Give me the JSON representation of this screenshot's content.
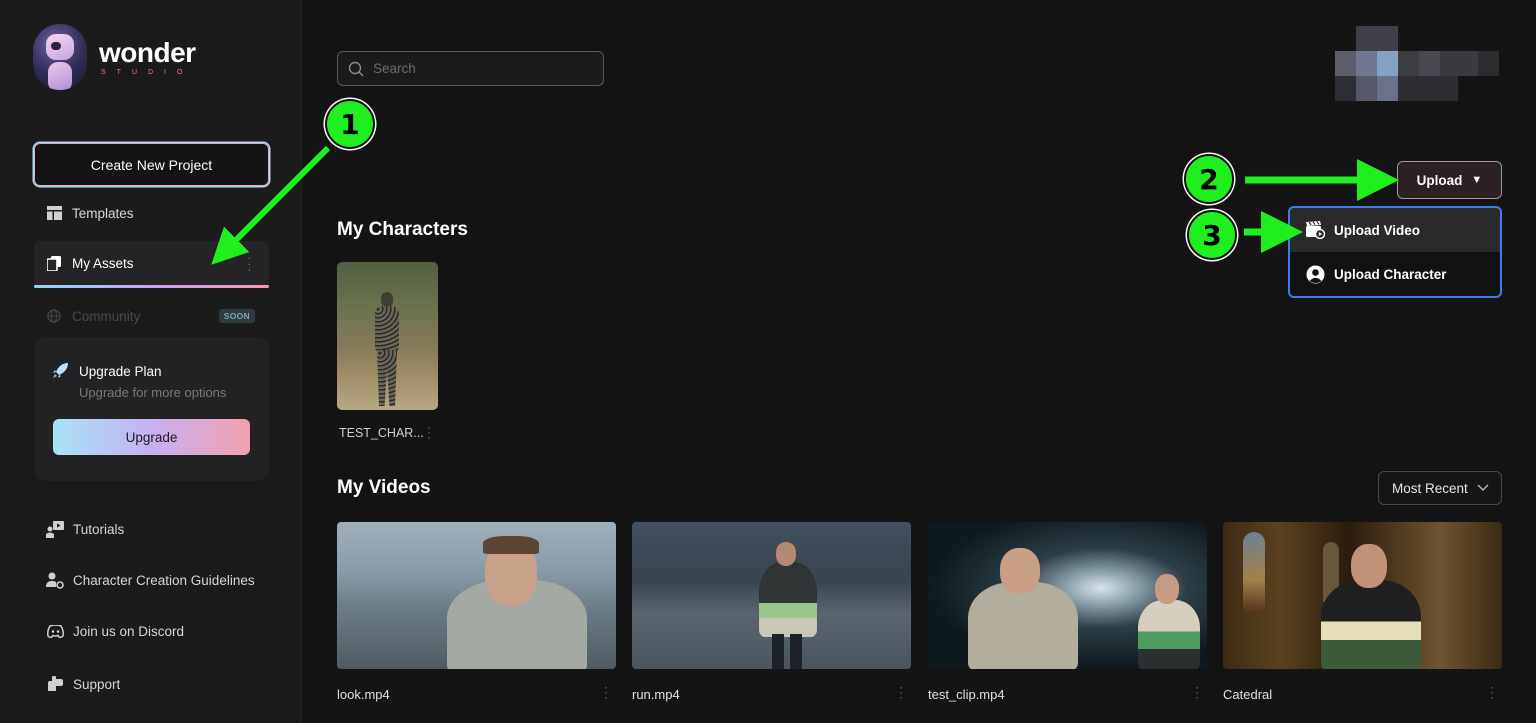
{
  "app": {
    "logo_word": "wonder",
    "logo_sub": "STUDIO"
  },
  "sidebar": {
    "create_button": "Create New Project",
    "items": [
      {
        "label": "Templates",
        "icon": "layout-icon"
      },
      {
        "label": "My Assets",
        "icon": "copy-icon",
        "active": true
      },
      {
        "label": "Community",
        "icon": "globe-icon",
        "badge": "SOON",
        "disabled": true
      }
    ],
    "upgrade": {
      "title": "Upgrade Plan",
      "subtitle": "Upgrade for more options",
      "button": "Upgrade"
    },
    "footer_items": [
      {
        "label": "Tutorials",
        "icon": "tutorial-icon"
      },
      {
        "label": "Character Creation Guidelines",
        "icon": "user-settings-icon"
      },
      {
        "label": "Join us on Discord",
        "icon": "discord-icon"
      },
      {
        "label": "Support",
        "icon": "support-icon"
      }
    ]
  },
  "search": {
    "placeholder": "Search",
    "value": ""
  },
  "upload": {
    "button": "Upload",
    "menu": [
      {
        "label": "Upload Video",
        "icon": "clapperboard-icon"
      },
      {
        "label": "Upload Character",
        "icon": "user-circle-icon"
      }
    ]
  },
  "characters": {
    "title": "My Characters",
    "items": [
      {
        "name": "TEST_CHAR..."
      }
    ]
  },
  "videos": {
    "title": "My Videos",
    "sort": "Most Recent",
    "items": [
      {
        "name": "look.mp4"
      },
      {
        "name": "run.mp4"
      },
      {
        "name": "test_clip.mp4"
      },
      {
        "name": "Catedral"
      }
    ]
  },
  "annotations": {
    "step1": "1",
    "step2": "2",
    "step3": "3",
    "color": "#1fef1f"
  }
}
